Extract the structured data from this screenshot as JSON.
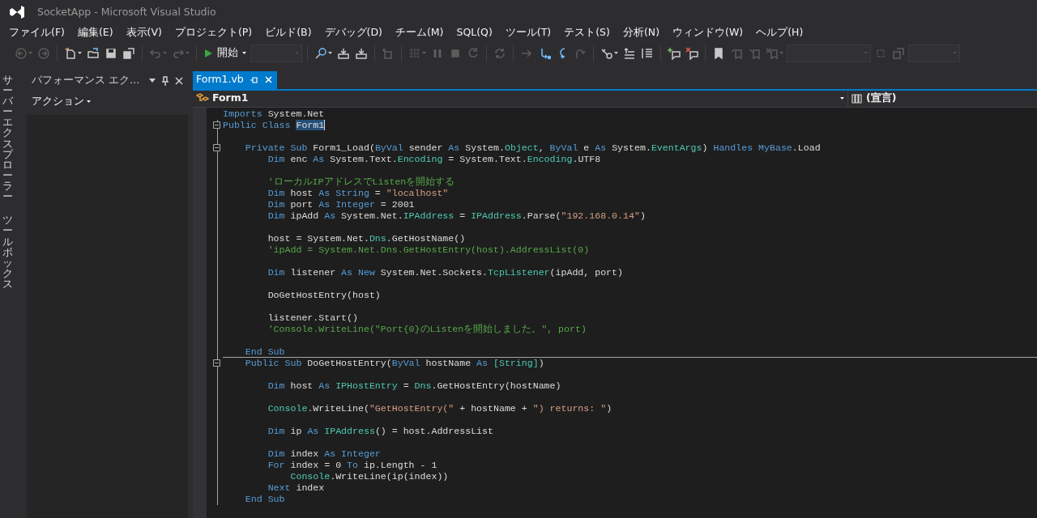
{
  "window": {
    "title": "SocketApp - Microsoft Visual Studio"
  },
  "menu": [
    "ファイル(F)",
    "編集(E)",
    "表示(V)",
    "プロジェクト(P)",
    "ビルド(B)",
    "デバッグ(D)",
    "チーム(M)",
    "SQL(Q)",
    "ツール(T)",
    "テスト(S)",
    "分析(N)",
    "ウィンドウ(W)",
    "ヘルプ(H)"
  ],
  "toolbar": [
    {
      "kind": "button",
      "disabled": true,
      "dropdown": true
    },
    {
      "kind": "button",
      "disabled": true,
      "dropdown": false
    },
    {
      "kind": "separator"
    },
    {
      "kind": "button",
      "disabled": false,
      "dropdown": true
    },
    {
      "kind": "button",
      "disabled": false,
      "dropdown": false
    },
    {
      "kind": "button",
      "disabled": false,
      "dropdown": false
    },
    {
      "kind": "button",
      "disabled": false,
      "dropdown": false
    },
    {
      "kind": "separator"
    },
    {
      "kind": "button",
      "disabled": true,
      "dropdown": true
    },
    {
      "kind": "button",
      "disabled": true,
      "dropdown": true
    },
    {
      "kind": "separator"
    },
    {
      "kind": "start",
      "label": "開始",
      "dropdown": true
    },
    {
      "kind": "combo",
      "disabled": true
    },
    {
      "kind": "separator"
    },
    {
      "kind": "button",
      "disabled": false,
      "dropdown": true
    },
    {
      "kind": "button",
      "disabled": false,
      "dropdown": false
    },
    {
      "kind": "button",
      "disabled": false,
      "dropdown": false
    },
    {
      "kind": "separator"
    },
    {
      "kind": "button",
      "disabled": true,
      "dropdown": false
    },
    {
      "kind": "separator"
    },
    {
      "kind": "button",
      "disabled": true,
      "dropdown": true
    },
    {
      "kind": "button",
      "disabled": true,
      "dropdown": false
    },
    {
      "kind": "button",
      "disabled": true,
      "dropdown": false
    },
    {
      "kind": "button",
      "disabled": true,
      "dropdown": false
    },
    {
      "kind": "separator"
    },
    {
      "kind": "button",
      "disabled": true,
      "dropdown": false
    },
    {
      "kind": "separator"
    },
    {
      "kind": "button",
      "disabled": true,
      "dropdown": false
    },
    {
      "kind": "button",
      "disabled": false,
      "dropdown": false
    },
    {
      "kind": "button",
      "disabled": false,
      "dropdown": false
    },
    {
      "kind": "button",
      "disabled": true,
      "dropdown": false
    },
    {
      "kind": "separator"
    },
    {
      "kind": "button",
      "disabled": false,
      "dropdown": true
    },
    {
      "kind": "button",
      "disabled": false,
      "dropdown": false
    },
    {
      "kind": "button",
      "disabled": false,
      "dropdown": false
    },
    {
      "kind": "separator"
    },
    {
      "kind": "button",
      "disabled": false,
      "dropdown": false
    },
    {
      "kind": "button",
      "disabled": false,
      "dropdown": false
    },
    {
      "kind": "separator"
    },
    {
      "kind": "button",
      "disabled": false,
      "dropdown": false
    },
    {
      "kind": "button",
      "disabled": true,
      "dropdown": false
    },
    {
      "kind": "button",
      "disabled": true,
      "dropdown": false
    },
    {
      "kind": "button",
      "disabled": true,
      "dropdown": true
    },
    {
      "kind": "combo",
      "disabled": true
    },
    {
      "kind": "button",
      "disabled": true,
      "dropdown": false
    },
    {
      "kind": "button",
      "disabled": true,
      "dropdown": false
    },
    {
      "kind": "combo",
      "disabled": true
    }
  ],
  "side_tabs": [
    {
      "label": "サーバーエクスプローラー"
    },
    {
      "label": "ツールボックス"
    }
  ],
  "tool_panel": {
    "title": "パフォーマンス エク…",
    "action": "アクション"
  },
  "editor_tabs": [
    {
      "label": "Form1.vb",
      "selected": true
    }
  ],
  "nav_bar": {
    "type_combo": "Form1",
    "member_combo": "(宣言)"
  },
  "code_lines": [
    {
      "fold": false,
      "divider": false,
      "tokens": [
        {
          "kind": "keyword",
          "text": "Imports"
        },
        {
          "kind": "plain",
          "text": " System.Net"
        }
      ]
    },
    {
      "fold": true,
      "divider": false,
      "tokens": [
        {
          "kind": "keyword",
          "text": "Public Class "
        },
        {
          "kind": "selected",
          "text": "Form1"
        }
      ]
    },
    {
      "fold": false,
      "divider": false
    },
    {
      "fold": true,
      "divider": false,
      "tokens": [
        {
          "kind": "keyword",
          "text": "    Private Sub"
        },
        {
          "kind": "plain",
          "text": " Form1_Load("
        },
        {
          "kind": "keyword",
          "text": "ByVal"
        },
        {
          "kind": "plain",
          "text": " sender "
        },
        {
          "kind": "keyword",
          "text": "As"
        },
        {
          "kind": "plain",
          "text": " System."
        },
        {
          "kind": "type",
          "text": "Object"
        },
        {
          "kind": "plain",
          "text": ", "
        },
        {
          "kind": "keyword",
          "text": "ByVal"
        },
        {
          "kind": "plain",
          "text": " e "
        },
        {
          "kind": "keyword",
          "text": "As"
        },
        {
          "kind": "plain",
          "text": " System."
        },
        {
          "kind": "type",
          "text": "EventArgs"
        },
        {
          "kind": "plain",
          "text": ") "
        },
        {
          "kind": "keyword",
          "text": "Handles MyBase"
        },
        {
          "kind": "plain",
          "text": ".Load"
        }
      ]
    },
    {
      "fold": false,
      "divider": false,
      "tokens": [
        {
          "kind": "keyword",
          "text": "        Dim"
        },
        {
          "kind": "plain",
          "text": " enc "
        },
        {
          "kind": "keyword",
          "text": "As"
        },
        {
          "kind": "plain",
          "text": " System.Text."
        },
        {
          "kind": "type",
          "text": "Encoding"
        },
        {
          "kind": "plain",
          "text": " = System.Text."
        },
        {
          "kind": "type",
          "text": "Encoding"
        },
        {
          "kind": "plain",
          "text": ".UTF8"
        }
      ]
    },
    {
      "fold": false,
      "divider": false
    },
    {
      "fold": false,
      "divider": false,
      "tokens": [
        {
          "kind": "comment",
          "text": "        'ローカルIPアドレスでListenを開始する"
        }
      ]
    },
    {
      "fold": false,
      "divider": false,
      "tokens": [
        {
          "kind": "keyword",
          "text": "        Dim"
        },
        {
          "kind": "plain",
          "text": " host "
        },
        {
          "kind": "keyword",
          "text": "As String"
        },
        {
          "kind": "plain",
          "text": " = "
        },
        {
          "kind": "string",
          "text": "\"localhost\""
        }
      ]
    },
    {
      "fold": false,
      "divider": false,
      "tokens": [
        {
          "kind": "keyword",
          "text": "        Dim"
        },
        {
          "kind": "plain",
          "text": " port "
        },
        {
          "kind": "keyword",
          "text": "As Integer"
        },
        {
          "kind": "plain",
          "text": " = 2001"
        }
      ]
    },
    {
      "fold": false,
      "divider": false,
      "tokens": [
        {
          "kind": "keyword",
          "text": "        Dim"
        },
        {
          "kind": "plain",
          "text": " ipAdd "
        },
        {
          "kind": "keyword",
          "text": "As"
        },
        {
          "kind": "plain",
          "text": " System.Net."
        },
        {
          "kind": "type",
          "text": "IPAddress"
        },
        {
          "kind": "plain",
          "text": " = "
        },
        {
          "kind": "type",
          "text": "IPAddress"
        },
        {
          "kind": "plain",
          "text": ".Parse("
        },
        {
          "kind": "string",
          "text": "\"192.168.0.14\""
        },
        {
          "kind": "plain",
          "text": ")"
        }
      ]
    },
    {
      "fold": false,
      "divider": false
    },
    {
      "fold": false,
      "divider": false,
      "tokens": [
        {
          "kind": "plain",
          "text": "        host = System.Net."
        },
        {
          "kind": "type",
          "text": "Dns"
        },
        {
          "kind": "plain",
          "text": ".GetHostName()"
        }
      ]
    },
    {
      "fold": false,
      "divider": false,
      "tokens": [
        {
          "kind": "comment",
          "text": "        'ipAdd = System.Net.Dns.GetHostEntry(host).AddressList(0)"
        }
      ]
    },
    {
      "fold": false,
      "divider": false
    },
    {
      "fold": false,
      "divider": false,
      "tokens": [
        {
          "kind": "keyword",
          "text": "        Dim"
        },
        {
          "kind": "plain",
          "text": " listener "
        },
        {
          "kind": "keyword",
          "text": "As New"
        },
        {
          "kind": "plain",
          "text": " System.Net.Sockets."
        },
        {
          "kind": "type",
          "text": "TcpListener"
        },
        {
          "kind": "plain",
          "text": "(ipAdd, port)"
        }
      ]
    },
    {
      "fold": false,
      "divider": false
    },
    {
      "fold": false,
      "divider": false,
      "tokens": [
        {
          "kind": "plain",
          "text": "        DoGetHostEntry(host)"
        }
      ]
    },
    {
      "fold": false,
      "divider": false
    },
    {
      "fold": false,
      "divider": false,
      "tokens": [
        {
          "kind": "plain",
          "text": "        listener.Start()"
        }
      ]
    },
    {
      "fold": false,
      "divider": false,
      "tokens": [
        {
          "kind": "comment",
          "text": "        'Console.WriteLine(\"Port{0}のListenを開始しました。\", port)"
        }
      ]
    },
    {
      "fold": false,
      "divider": false
    },
    {
      "fold": false,
      "divider": true,
      "tokens": [
        {
          "kind": "keyword",
          "text": "    End Sub"
        }
      ]
    },
    {
      "fold": true,
      "divider": false,
      "tokens": [
        {
          "kind": "keyword",
          "text": "    Public Sub"
        },
        {
          "kind": "plain",
          "text": " DoGetHostEntry("
        },
        {
          "kind": "keyword",
          "text": "ByVal"
        },
        {
          "kind": "plain",
          "text": " hostName "
        },
        {
          "kind": "keyword",
          "text": "As "
        },
        {
          "kind": "type",
          "text": "[String]"
        },
        {
          "kind": "plain",
          "text": ")"
        }
      ]
    },
    {
      "fold": false,
      "divider": false
    },
    {
      "fold": false,
      "divider": false,
      "tokens": [
        {
          "kind": "keyword",
          "text": "        Dim"
        },
        {
          "kind": "plain",
          "text": " host "
        },
        {
          "kind": "keyword",
          "text": "As "
        },
        {
          "kind": "type",
          "text": "IPHostEntry"
        },
        {
          "kind": "plain",
          "text": " = "
        },
        {
          "kind": "type",
          "text": "Dns"
        },
        {
          "kind": "plain",
          "text": ".GetHostEntry(hostName)"
        }
      ]
    },
    {
      "fold": false,
      "divider": false
    },
    {
      "fold": false,
      "divider": false,
      "tokens": [
        {
          "kind": "type",
          "text": "        Console"
        },
        {
          "kind": "plain",
          "text": ".WriteLine("
        },
        {
          "kind": "string",
          "text": "\"GetHostEntry(\""
        },
        {
          "kind": "plain",
          "text": " + hostName + "
        },
        {
          "kind": "string",
          "text": "\") returns: \""
        },
        {
          "kind": "plain",
          "text": ")"
        }
      ]
    },
    {
      "fold": false,
      "divider": false
    },
    {
      "fold": false,
      "divider": false,
      "tokens": [
        {
          "kind": "keyword",
          "text": "        Dim"
        },
        {
          "kind": "plain",
          "text": " ip "
        },
        {
          "kind": "keyword",
          "text": "As "
        },
        {
          "kind": "type",
          "text": "IPAddress"
        },
        {
          "kind": "plain",
          "text": "() = host.AddressList"
        }
      ]
    },
    {
      "fold": false,
      "divider": false
    },
    {
      "fold": false,
      "divider": false,
      "tokens": [
        {
          "kind": "keyword",
          "text": "        Dim"
        },
        {
          "kind": "plain",
          "text": " index "
        },
        {
          "kind": "keyword",
          "text": "As Integer"
        }
      ]
    },
    {
      "fold": false,
      "divider": false,
      "tokens": [
        {
          "kind": "keyword",
          "text": "        For"
        },
        {
          "kind": "plain",
          "text": " index = 0 "
        },
        {
          "kind": "keyword",
          "text": "To"
        },
        {
          "kind": "plain",
          "text": " ip.Length - 1"
        }
      ]
    },
    {
      "fold": false,
      "divider": false,
      "tokens": [
        {
          "kind": "type",
          "text": "            Console"
        },
        {
          "kind": "plain",
          "text": ".WriteLine(ip(index))"
        }
      ]
    },
    {
      "fold": false,
      "divider": false,
      "tokens": [
        {
          "kind": "keyword",
          "text": "        Next"
        },
        {
          "kind": "plain",
          "text": " index"
        }
      ]
    },
    {
      "fold": false,
      "divider": false,
      "tokens": [
        {
          "kind": "keyword",
          "text": "    End Sub"
        }
      ]
    }
  ]
}
